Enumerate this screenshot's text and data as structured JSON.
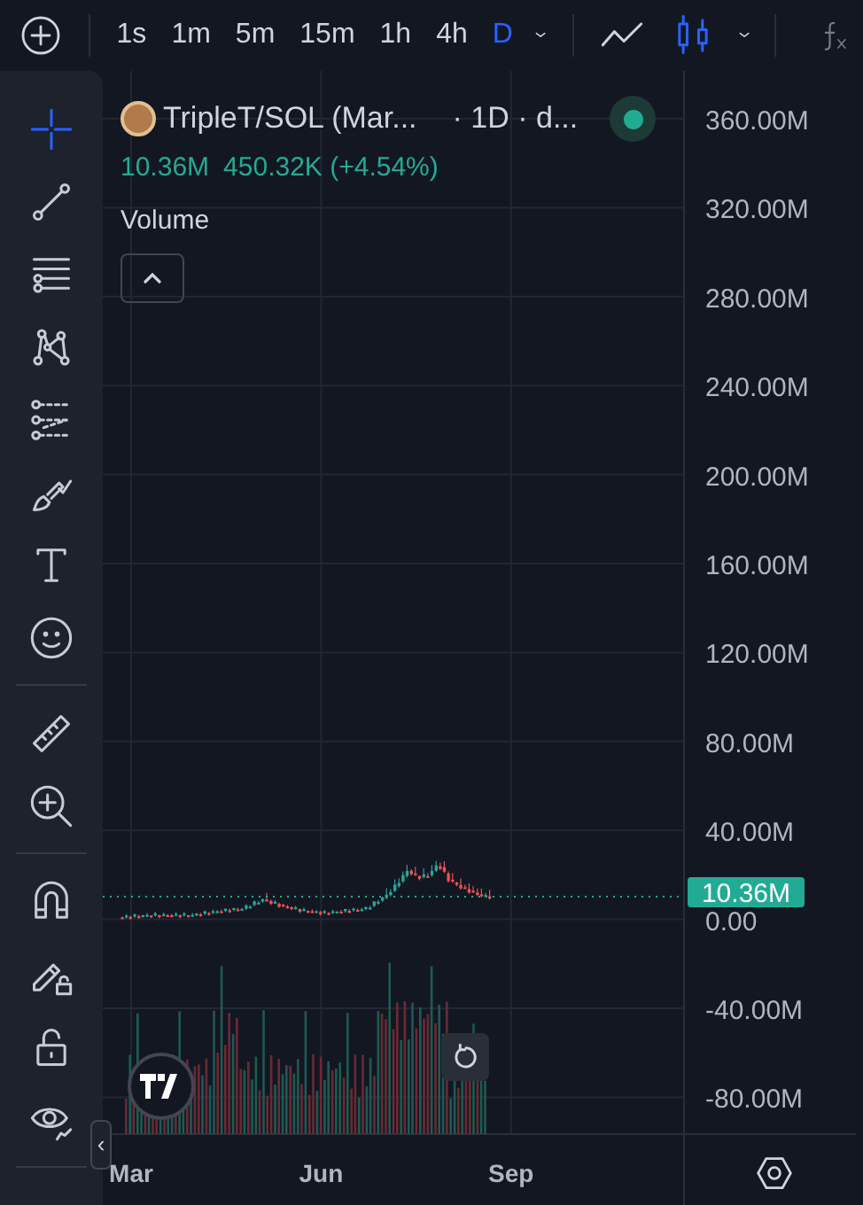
{
  "toolbar": {
    "intervals": [
      {
        "label": "1s",
        "selected": false
      },
      {
        "label": "1m",
        "selected": false
      },
      {
        "label": "5m",
        "selected": false
      },
      {
        "label": "15m",
        "selected": false
      },
      {
        "label": "1h",
        "selected": false
      },
      {
        "label": "4h",
        "selected": false
      },
      {
        "label": "D",
        "selected": true
      }
    ],
    "chart_types": [
      {
        "kind": "line",
        "selected": false
      },
      {
        "kind": "candles",
        "selected": true
      }
    ]
  },
  "tools": [
    {
      "kind": "crosshair",
      "selected": true
    },
    {
      "kind": "trend-line",
      "selected": false
    },
    {
      "kind": "fib",
      "selected": false
    },
    {
      "kind": "pattern",
      "selected": false
    },
    {
      "kind": "forecast",
      "selected": false
    },
    {
      "kind": "brush",
      "selected": false
    },
    {
      "kind": "text",
      "selected": false
    },
    {
      "kind": "emoji",
      "selected": false
    },
    {
      "kind": "divider"
    },
    {
      "kind": "ruler",
      "selected": false
    },
    {
      "kind": "zoom",
      "selected": false
    },
    {
      "kind": "divider"
    },
    {
      "kind": "magnet",
      "selected": false
    },
    {
      "kind": "draw-lock",
      "selected": false
    },
    {
      "kind": "lock",
      "selected": false
    },
    {
      "kind": "eye",
      "selected": false
    },
    {
      "kind": "divider"
    }
  ],
  "legend": {
    "symbol": "TripleT/SOL (Mar...",
    "interval": "· 1D · d...",
    "live": true,
    "last": "10.36M",
    "change": "450.32K (+4.54%)",
    "indicator": "Volume"
  },
  "chart": {
    "price_label": "10.36M",
    "collapse_handle": "‹",
    "x_axis_labels": [
      "Mar",
      "Jun",
      "Sep"
    ],
    "y_axis_labels": [
      "360.00M",
      "320.00M",
      "280.00M",
      "240.00M",
      "200.00M",
      "160.00M",
      "120.00M",
      "80.00M",
      "40.00M",
      "0.00",
      "-40.00M",
      "-80.00M"
    ]
  }
}
